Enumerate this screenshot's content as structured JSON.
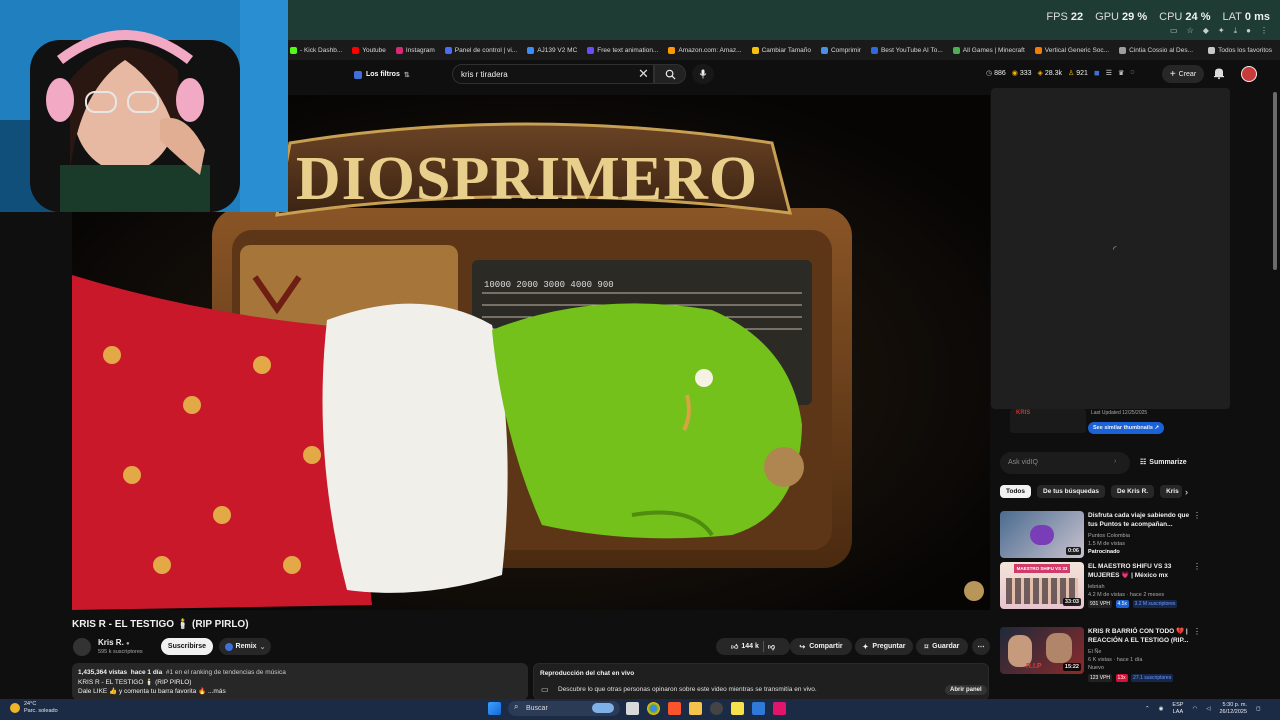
{
  "perf": {
    "fps_label": "FPS",
    "fps": "22",
    "gpu_label": "GPU",
    "gpu": "29 %",
    "cpu_label": "CPU",
    "cpu": "24 %",
    "lat_label": "LAT",
    "lat": "0 ms"
  },
  "bookmarks": [
    {
      "label": "- Kick Dashb...",
      "color": "#53fc18"
    },
    {
      "label": "Youtube",
      "color": "#ff0000"
    },
    {
      "label": "Instagram",
      "color": "#d62976"
    },
    {
      "label": "Panel de control | vi...",
      "color": "#4a6cf7"
    },
    {
      "label": "AJ139 V2 MC",
      "color": "#3a8ef6"
    },
    {
      "label": "Free text animation...",
      "color": "#6c4cf5"
    },
    {
      "label": "Amazon.com: Amaz...",
      "color": "#ff9900"
    },
    {
      "label": "Cambiar Tamaño",
      "color": "#f4c20d"
    },
    {
      "label": "Comprimir",
      "color": "#4a90e2"
    },
    {
      "label": "Best YouTube AI To...",
      "color": "#2e6bd8"
    },
    {
      "label": "All Games | Minecraft",
      "color": "#4caf50"
    },
    {
      "label": "Vertical Generic Soc...",
      "color": "#f57c00"
    },
    {
      "label": "Cintia Cossio al Des...",
      "color": "#9e9e9e"
    }
  ],
  "bookmarks_all": "Todos los favoritos",
  "header": {
    "filters_label": "Los filtros",
    "search_value": "kris r tiradera",
    "stats": [
      "886",
      "333",
      "28.3k",
      "921"
    ],
    "create_label": "Crear"
  },
  "video": {
    "sign_text": "DIOSPRIMERO"
  },
  "panel": {
    "last_updated": "Last Updated 12/25/2025",
    "similar_label": "See similar thumbnails",
    "ask_placeholder": "Ask vidIQ",
    "summarize_label": "Summarize",
    "chips": [
      "Todos",
      "De tus búsquedas",
      "De Kris R.",
      "Kris"
    ]
  },
  "recommendations": [
    {
      "title": "Disfruta cada viaje sabiendo que tus Puntos te acompañan...",
      "channel": "Puntos Colombia",
      "views": "1.5 M de vistas",
      "extra": "Patrocinado",
      "duration": "0:06",
      "thumb_colors": [
        "#4a6b8f",
        "#c9c2cf"
      ]
    },
    {
      "title": "EL MAESTRO SHIFU VS 33 MUJERES 💗 | México mx",
      "channel": "lebriah",
      "views": "4.2 M de vistas · hace 2 meses",
      "vph": "931 VPH",
      "badge": "4.5x",
      "subs": "3.2 M suscriptores",
      "duration": "33:03",
      "thumb_label": "MAESTRO SHIFU VS 33 MUJERES",
      "thumb_colors": [
        "#f2e4d8",
        "#d13b6a"
      ]
    },
    {
      "title": "KRIS R BARRIÓ CON TODO 💔 | REACCIÓN A EL TESTIGO (RIP...",
      "channel": "El Ñe",
      "views": "6 K vistas · hace 1 día",
      "extra": "Nuevo",
      "vph": "123 VPH",
      "badge": "13x",
      "subs": "27.1 suscriptores",
      "duration": "15:22",
      "thumb_label": "R.I.P",
      "thumb_colors": [
        "#1d2a3a",
        "#8a2b2b"
      ]
    }
  ],
  "meta": {
    "title": "KRIS R - EL TESTIGO 🕯️ (RIP PIRLO)",
    "channel": "Kris R.",
    "subs": "595 k suscriptores",
    "subscribe_label": "Suscribirse",
    "remix_label": "Remix",
    "likes": "144 k",
    "share_label": "Compartir",
    "ask_label": "Preguntar",
    "save_label": "Guardar",
    "desc_line1_views": "1,435,364 vistas",
    "desc_line1_time": "hace 1 día",
    "desc_line1_rank": "#1 en el ranking de tendencias de música",
    "desc_line2": "KRIS R - EL TESTIGO 🕯️ (RIP PIRLO)",
    "desc_line3": "Dale LIKE 👍 y comenta tu barra favorita 🔥 ...más"
  },
  "chat": {
    "title": "Reproducción del chat en vivo",
    "desc": "Descubre lo que otras personas opinaron sobre este video mientras se transmitía en vivo.",
    "open_label": "Abrir panel"
  },
  "taskbar": {
    "temp": "24°C",
    "weather": "Parc. soleado",
    "search_label": "Buscar",
    "lang1": "ESP",
    "lang2": "LAA",
    "time": "5:30 p. m.",
    "date": "26/12/2025"
  }
}
